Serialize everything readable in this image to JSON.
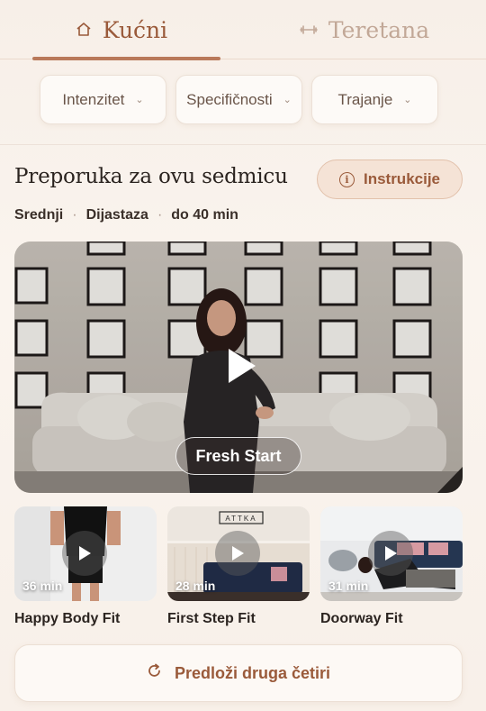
{
  "tabs": [
    {
      "label": "Kućni",
      "icon": "home-icon",
      "active": true
    },
    {
      "label": "Teretana",
      "icon": "dumbbell-icon",
      "active": false
    }
  ],
  "filters": [
    {
      "label": "Intenzitet"
    },
    {
      "label": "Specifičnosti"
    },
    {
      "label": "Trajanje"
    }
  ],
  "recommendation": {
    "title": "Preporuka za ovu sedmicu",
    "instructions_label": "Instrukcije",
    "meta": [
      "Srednji",
      "Dijastaza",
      "do 40 min"
    ]
  },
  "hero": {
    "label": "Fresh Start"
  },
  "thumbnails": [
    {
      "title": "Happy Body Fit",
      "duration": "36 min"
    },
    {
      "title": "First Step Fit",
      "duration": "28 min",
      "sign": "ATTKA"
    },
    {
      "title": "Doorway Fit",
      "duration": "31 min"
    }
  ],
  "suggest_button": {
    "label": "Predloži druga četiri"
  },
  "colors": {
    "accent": "#9a5a3a",
    "background": "#f7efe8"
  }
}
